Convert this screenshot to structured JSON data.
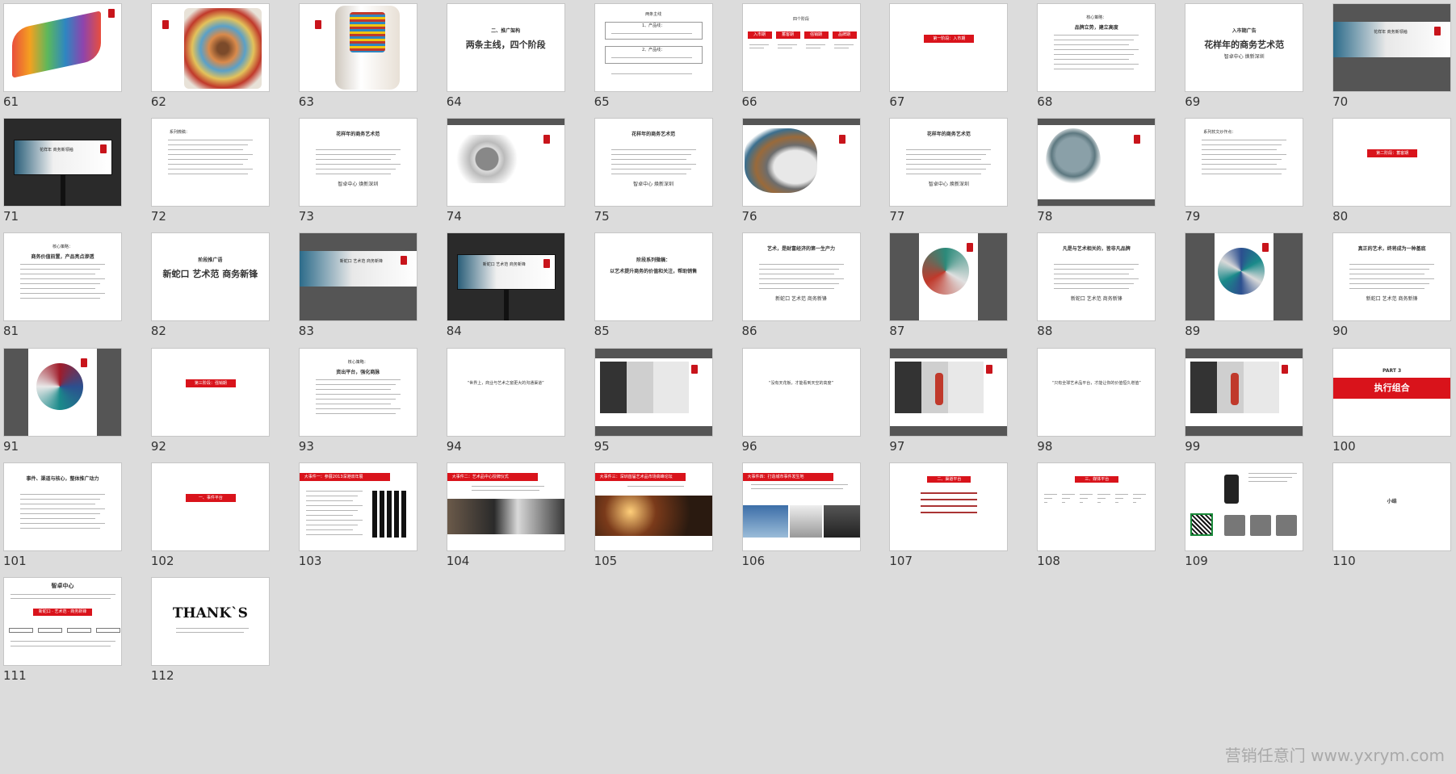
{
  "slides": [
    {
      "num": "61",
      "kind": "image-ribbon"
    },
    {
      "num": "62",
      "kind": "image-rings"
    },
    {
      "num": "63",
      "kind": "image-cylinder"
    },
    {
      "num": "64",
      "kind": "title",
      "heading": "二、推广架构",
      "red": "两条主线，四个阶段"
    },
    {
      "num": "65",
      "kind": "boxes",
      "heading": "两条主线",
      "label1": "1、产品线：",
      "label2": "2、产品线："
    },
    {
      "num": "66",
      "kind": "phases",
      "heading": "四个阶段",
      "tags": [
        "入市期",
        "蓄客期",
        "强销期",
        "品牌期"
      ]
    },
    {
      "num": "67",
      "kind": "redbar",
      "bar": "第一阶段：入市期"
    },
    {
      "num": "68",
      "kind": "text",
      "heading": "核心策略：",
      "red": "品牌立势，建立高度"
    },
    {
      "num": "69",
      "kind": "title",
      "heading": "入市期广告",
      "red": "花样年的商务艺术范",
      "sub": "智卓中心 焕新深圳"
    },
    {
      "num": "70",
      "kind": "banner-dark",
      "caption": "花样年 商务新领袖"
    },
    {
      "num": "71",
      "kind": "billboard",
      "caption": "花样年 商务新领袖"
    },
    {
      "num": "72",
      "kind": "text",
      "heading": "系列微稿："
    },
    {
      "num": "73",
      "kind": "text",
      "red": "花样年的商务艺术范",
      "sub": "智卓中心 焕新深圳"
    },
    {
      "num": "74",
      "kind": "image-clock"
    },
    {
      "num": "75",
      "kind": "text",
      "red": "花样年的商务艺术范",
      "sub": "智卓中心 焕新深圳"
    },
    {
      "num": "76",
      "kind": "image-head"
    },
    {
      "num": "77",
      "kind": "text",
      "red": "花样年的商务艺术范",
      "sub": "智卓中心 焕新深圳"
    },
    {
      "num": "78",
      "kind": "image-tree"
    },
    {
      "num": "79",
      "kind": "text",
      "heading": "系列软文炒作点："
    },
    {
      "num": "80",
      "kind": "redbar",
      "bar": "第二阶段：蓄客期"
    },
    {
      "num": "81",
      "kind": "text",
      "heading": "核心策略：",
      "red": "商务价值前置，产品亮点渗透"
    },
    {
      "num": "82",
      "kind": "title",
      "heading": "阶段推广语",
      "red": "新蛇口 艺术范 商务新锋"
    },
    {
      "num": "83",
      "kind": "banner-dark",
      "caption": "新蛇口 艺术范 商务新锋"
    },
    {
      "num": "84",
      "kind": "billboard",
      "caption": "新蛇口 艺术范 商务新锋"
    },
    {
      "num": "85",
      "kind": "title",
      "heading": "阶段系列微稿：",
      "red": "以艺术提升商务的价值和关注，帮助销售"
    },
    {
      "num": "86",
      "kind": "text",
      "red": "艺术，是财富经济的第一生产力",
      "sub": "新蛇口 艺术范 商务新锋"
    },
    {
      "num": "87",
      "kind": "image-shell"
    },
    {
      "num": "88",
      "kind": "text",
      "red": "凡是与艺术相关的，皆非凡品牌",
      "sub": "新蛇口 艺术范 商务新锋"
    },
    {
      "num": "89",
      "kind": "image-burst"
    },
    {
      "num": "90",
      "kind": "text",
      "red": "真正的艺术，终将成为一种基底",
      "sub": "新蛇口 艺术范 商务新锋"
    },
    {
      "num": "91",
      "kind": "image-spiral"
    },
    {
      "num": "92",
      "kind": "redbar",
      "bar": "第三阶段：强销期"
    },
    {
      "num": "93",
      "kind": "text",
      "heading": "核心策略：",
      "red": "资出平台，强化商脉"
    },
    {
      "num": "94",
      "kind": "quote",
      "red": "“世界上，商业与艺术之窗更大的沟通渠道”"
    },
    {
      "num": "95",
      "kind": "gallery"
    },
    {
      "num": "96",
      "kind": "quote",
      "red": "“没有天花板，才能看到天空的高度”"
    },
    {
      "num": "97",
      "kind": "gallery-red"
    },
    {
      "num": "98",
      "kind": "quote",
      "red": "“只有全球艺术品平台，才能让你的价值恒久增值”"
    },
    {
      "num": "99",
      "kind": "gallery-red"
    },
    {
      "num": "100",
      "kind": "part",
      "heading": "PART 3",
      "red": "执行组合"
    },
    {
      "num": "101",
      "kind": "text",
      "red": "事件、渠道与核心，整体推广动力"
    },
    {
      "num": "102",
      "kind": "redbar",
      "bar": "一、事件平台"
    },
    {
      "num": "103",
      "kind": "event",
      "bar": "大事件一：参展2013深港双年展"
    },
    {
      "num": "104",
      "kind": "event-photo",
      "bar": "大事件二：艺术品中心授牌仪式"
    },
    {
      "num": "105",
      "kind": "event-crowd",
      "bar": "大事件三：深圳首届艺术品市场高峰论坛"
    },
    {
      "num": "106",
      "kind": "event-city",
      "bar": "大事件四：打造城市事件发生地"
    },
    {
      "num": "107",
      "kind": "list",
      "bar": "二、渠道平台"
    },
    {
      "num": "108",
      "kind": "grid",
      "bar": "三、媒体平台"
    },
    {
      "num": "109",
      "kind": "devices"
    },
    {
      "num": "110",
      "kind": "title",
      "heading": "小结"
    },
    {
      "num": "111",
      "kind": "summary",
      "heading": "智卓中心",
      "red": "新蛇口 · 艺术范 · 商务新锋"
    },
    {
      "num": "112",
      "kind": "thanks",
      "heading": "THANK`S"
    }
  ],
  "watermark": "营销任意门 www.yxrym.com"
}
